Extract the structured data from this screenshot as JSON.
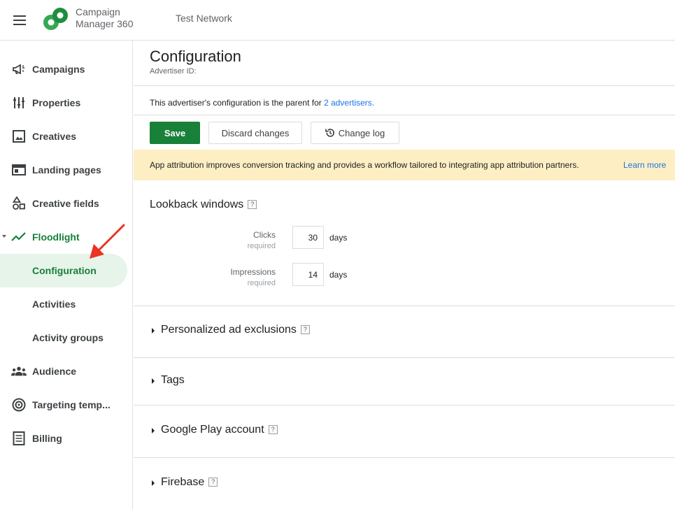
{
  "header": {
    "product_name": "Campaign Manager 360",
    "network_name": "Test Network"
  },
  "sidebar": {
    "items": [
      {
        "label": "Campaigns",
        "icon": "megaphone-icon"
      },
      {
        "label": "Properties",
        "icon": "sliders-icon"
      },
      {
        "label": "Creatives",
        "icon": "image-icon"
      },
      {
        "label": "Landing pages",
        "icon": "web-page-icon"
      },
      {
        "label": "Creative fields",
        "icon": "shapes-icon"
      },
      {
        "label": "Floodlight",
        "icon": "trend-line-icon"
      },
      {
        "label": "Configuration",
        "icon": ""
      },
      {
        "label": "Activities",
        "icon": ""
      },
      {
        "label": "Activity groups",
        "icon": ""
      },
      {
        "label": "Audience",
        "icon": "people-icon"
      },
      {
        "label": "Targeting temp...",
        "icon": "target-icon"
      },
      {
        "label": "Billing",
        "icon": "billing-icon"
      }
    ],
    "selected": "Configuration",
    "expanded": "Floodlight"
  },
  "main": {
    "title": "Configuration",
    "subtitle": "Advertiser ID:",
    "parent_note": "This advertiser's configuration is the parent for ",
    "parent_link": "2 advertisers.",
    "buttons": {
      "save": "Save",
      "discard": "Discard changes",
      "change_log": "Change log"
    },
    "banner": {
      "text": "App attribution improves conversion tracking and provides a workflow tailored to integrating app attribution partners.",
      "link": "Learn more"
    },
    "lookback": {
      "title": "Lookback windows",
      "help": "?",
      "clicks_label": "Clicks",
      "clicks_required": "required",
      "clicks_value": "30",
      "clicks_unit": "days",
      "impressions_label": "Impressions",
      "impressions_required": "required",
      "impressions_value": "14",
      "impressions_unit": "days"
    },
    "sections": [
      {
        "title": "Personalized ad exclusions",
        "help": "?"
      },
      {
        "title": "Tags",
        "help": ""
      },
      {
        "title": "Google Play account",
        "help": "?"
      },
      {
        "title": "Firebase",
        "help": "?"
      }
    ]
  },
  "colors": {
    "accent": "#188038",
    "link": "#1a73e8",
    "banner_bg": "#fdefc3",
    "selected_bg": "#e6f4ea",
    "annotation_arrow": "#ea3323"
  }
}
